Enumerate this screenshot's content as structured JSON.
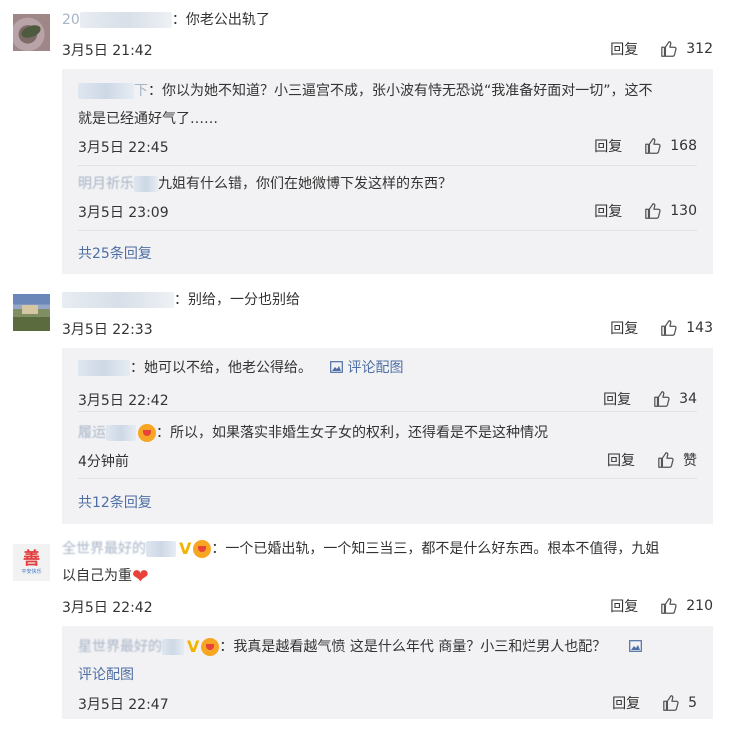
{
  "comments": [
    {
      "name_visible": "20",
      "text": "：你老公出轨了",
      "time": "3月5日 21:42",
      "reply_label": "回复",
      "likes": "312",
      "replies": [
        {
          "name_visible": "下",
          "text": "：你以为她不知道？小三逼宫不成，张小波有恃无恐说“我准备好面对一切”，这不",
          "text2": "就是已经通好气了……",
          "time": "3月5日 22:45",
          "reply_label": "回复",
          "likes": "168"
        },
        {
          "name_visible": "明月祈乐",
          "text": "九姐有什么错，你们在她微博下发这样的东西？",
          "time": "3月5日 23:09",
          "reply_label": "回复",
          "likes": "130"
        }
      ],
      "more": "共25条回复"
    },
    {
      "name_visible": "",
      "text": "：别给，一分也别给",
      "time": "3月5日 22:33",
      "reply_label": "回复",
      "likes": "143",
      "replies": [
        {
          "name_visible": "",
          "text": "：她可以不给，他老公得给。",
          "pic_link": "评论配图",
          "time": "3月5日 22:42",
          "reply_label": "回复",
          "likes": "34"
        },
        {
          "name_visible": "履运",
          "text": "：所以，如果落实非婚生女子女的权利，还得看是不是这种情况",
          "time": "4分钟前",
          "reply_label": "回复",
          "likes": "赞"
        }
      ],
      "more": "共12条回复"
    },
    {
      "name_visible": "全世界最好的",
      "text": "：一个已婚出轨，一个知三当三，都不是什么好东西。根本不值得，九姐",
      "text2": "以自己为重",
      "time": "3月5日 22:42",
      "reply_label": "回复",
      "likes": "210",
      "avatar_glyph": "善",
      "avatar_sub": "平安快乐",
      "replies": [
        {
          "name_visible": "星世界最好的",
          "text": "：我真是越看越气愤 这是什么年代 商量？小三和烂男人也配？",
          "pic_link": "评论配图",
          "time": "3月5日 22:47",
          "reply_label": "回复",
          "likes": "5"
        }
      ]
    }
  ],
  "icons": {
    "like": "thumbs-up-icon",
    "picture": "image-icon",
    "verified": "v-badge-icon",
    "heart": "heart-icon"
  },
  "colors": {
    "link": "#4e6fa3",
    "reply_bg": "#f2f2f4",
    "text": "#333333"
  }
}
